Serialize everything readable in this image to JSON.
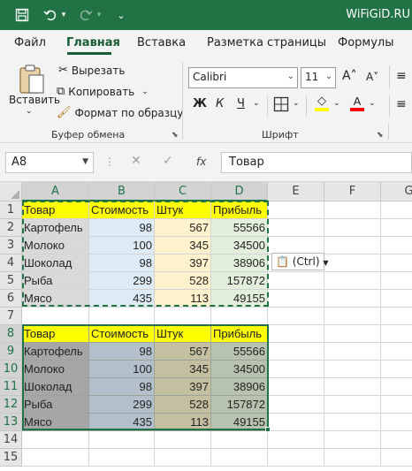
{
  "titlebar": {
    "title": "WiFiGiD.RU"
  },
  "tabs": [
    "Файл",
    "Главная",
    "Вставка",
    "Разметка страницы",
    "Формулы"
  ],
  "clipboard": {
    "paste": "Вставить",
    "cut": "Вырезать",
    "copy": "Копировать",
    "format_painter": "Формат по образцу",
    "group_label": "Буфер обмена"
  },
  "font": {
    "name": "Calibri",
    "size": "11",
    "bold": "Ж",
    "italic": "К",
    "underline": "Ч",
    "grow": "A˄",
    "shrink": "A˅",
    "group_label": "Шрифт"
  },
  "formula_bar": {
    "cell_ref": "A8",
    "fx": "fx",
    "value": "Товар"
  },
  "columns": [
    "A",
    "B",
    "C",
    "D",
    "E",
    "F",
    "G"
  ],
  "rows": [
    "1",
    "2",
    "3",
    "4",
    "5",
    "6",
    "7",
    "8",
    "9",
    "10",
    "11",
    "12",
    "13",
    "14",
    "15"
  ],
  "table_top": {
    "header": [
      "Товар",
      "Стоимость",
      "Штук",
      "Прибыль"
    ],
    "rows": [
      [
        "Картофель",
        "98",
        "567",
        "55566"
      ],
      [
        "Молоко",
        "100",
        "345",
        "34500"
      ],
      [
        "Шоколад",
        "98",
        "397",
        "38906"
      ],
      [
        "Рыба",
        "299",
        "528",
        "157872"
      ],
      [
        "Мясо",
        "435",
        "113",
        "49155"
      ]
    ]
  },
  "table_bottom": {
    "header": [
      "Товар",
      "Стоимость",
      "Штук",
      "Прибыль"
    ],
    "rows": [
      [
        "Картофель",
        "98",
        "567",
        "55566"
      ],
      [
        "Молоко",
        "100",
        "345",
        "34500"
      ],
      [
        "Шоколад",
        "98",
        "397",
        "38906"
      ],
      [
        "Рыба",
        "299",
        "528",
        "157872"
      ],
      [
        "Мясо",
        "435",
        "113",
        "49155"
      ]
    ]
  },
  "paste_options": {
    "label": "(Ctrl)"
  },
  "colors": {
    "brand": "#217346",
    "header_yellow": "#ffff00",
    "col_a_fill": "#d9d9d9",
    "col_b_fill": "#ddebf7",
    "col_c_fill": "#fff2cc",
    "col_d_fill": "#e2efda",
    "selection_tint": "#c9cfc9"
  }
}
